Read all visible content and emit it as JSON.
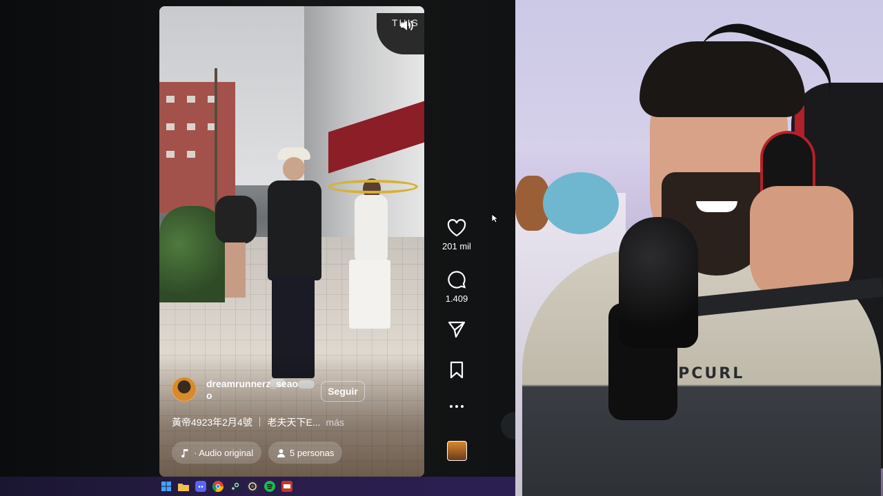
{
  "reel": {
    "username": "dreamrunnerz_seaoo",
    "follow_label": "Seguir",
    "caption": "黃帝4923年2月4號 ｜ 老夫天下E...",
    "caption_more": "más",
    "audio_label": "· Audio original",
    "people_label": "5 personas",
    "store_sign_text": "THIS"
  },
  "actions": {
    "likes": "201 mil",
    "comments": "1.409"
  },
  "stream": {
    "shirt_text": "RIPCURL"
  },
  "colors": {
    "taskbar": "#2a1d4a",
    "awning": "#8b1e26",
    "headphone_accent": "#b5202a"
  },
  "taskbar": {
    "icons": [
      "windows-icon",
      "file-explorer-icon",
      "discord-icon",
      "chrome-icon",
      "steam-icon",
      "obs-icon",
      "spotify-icon",
      "app-icon"
    ]
  }
}
